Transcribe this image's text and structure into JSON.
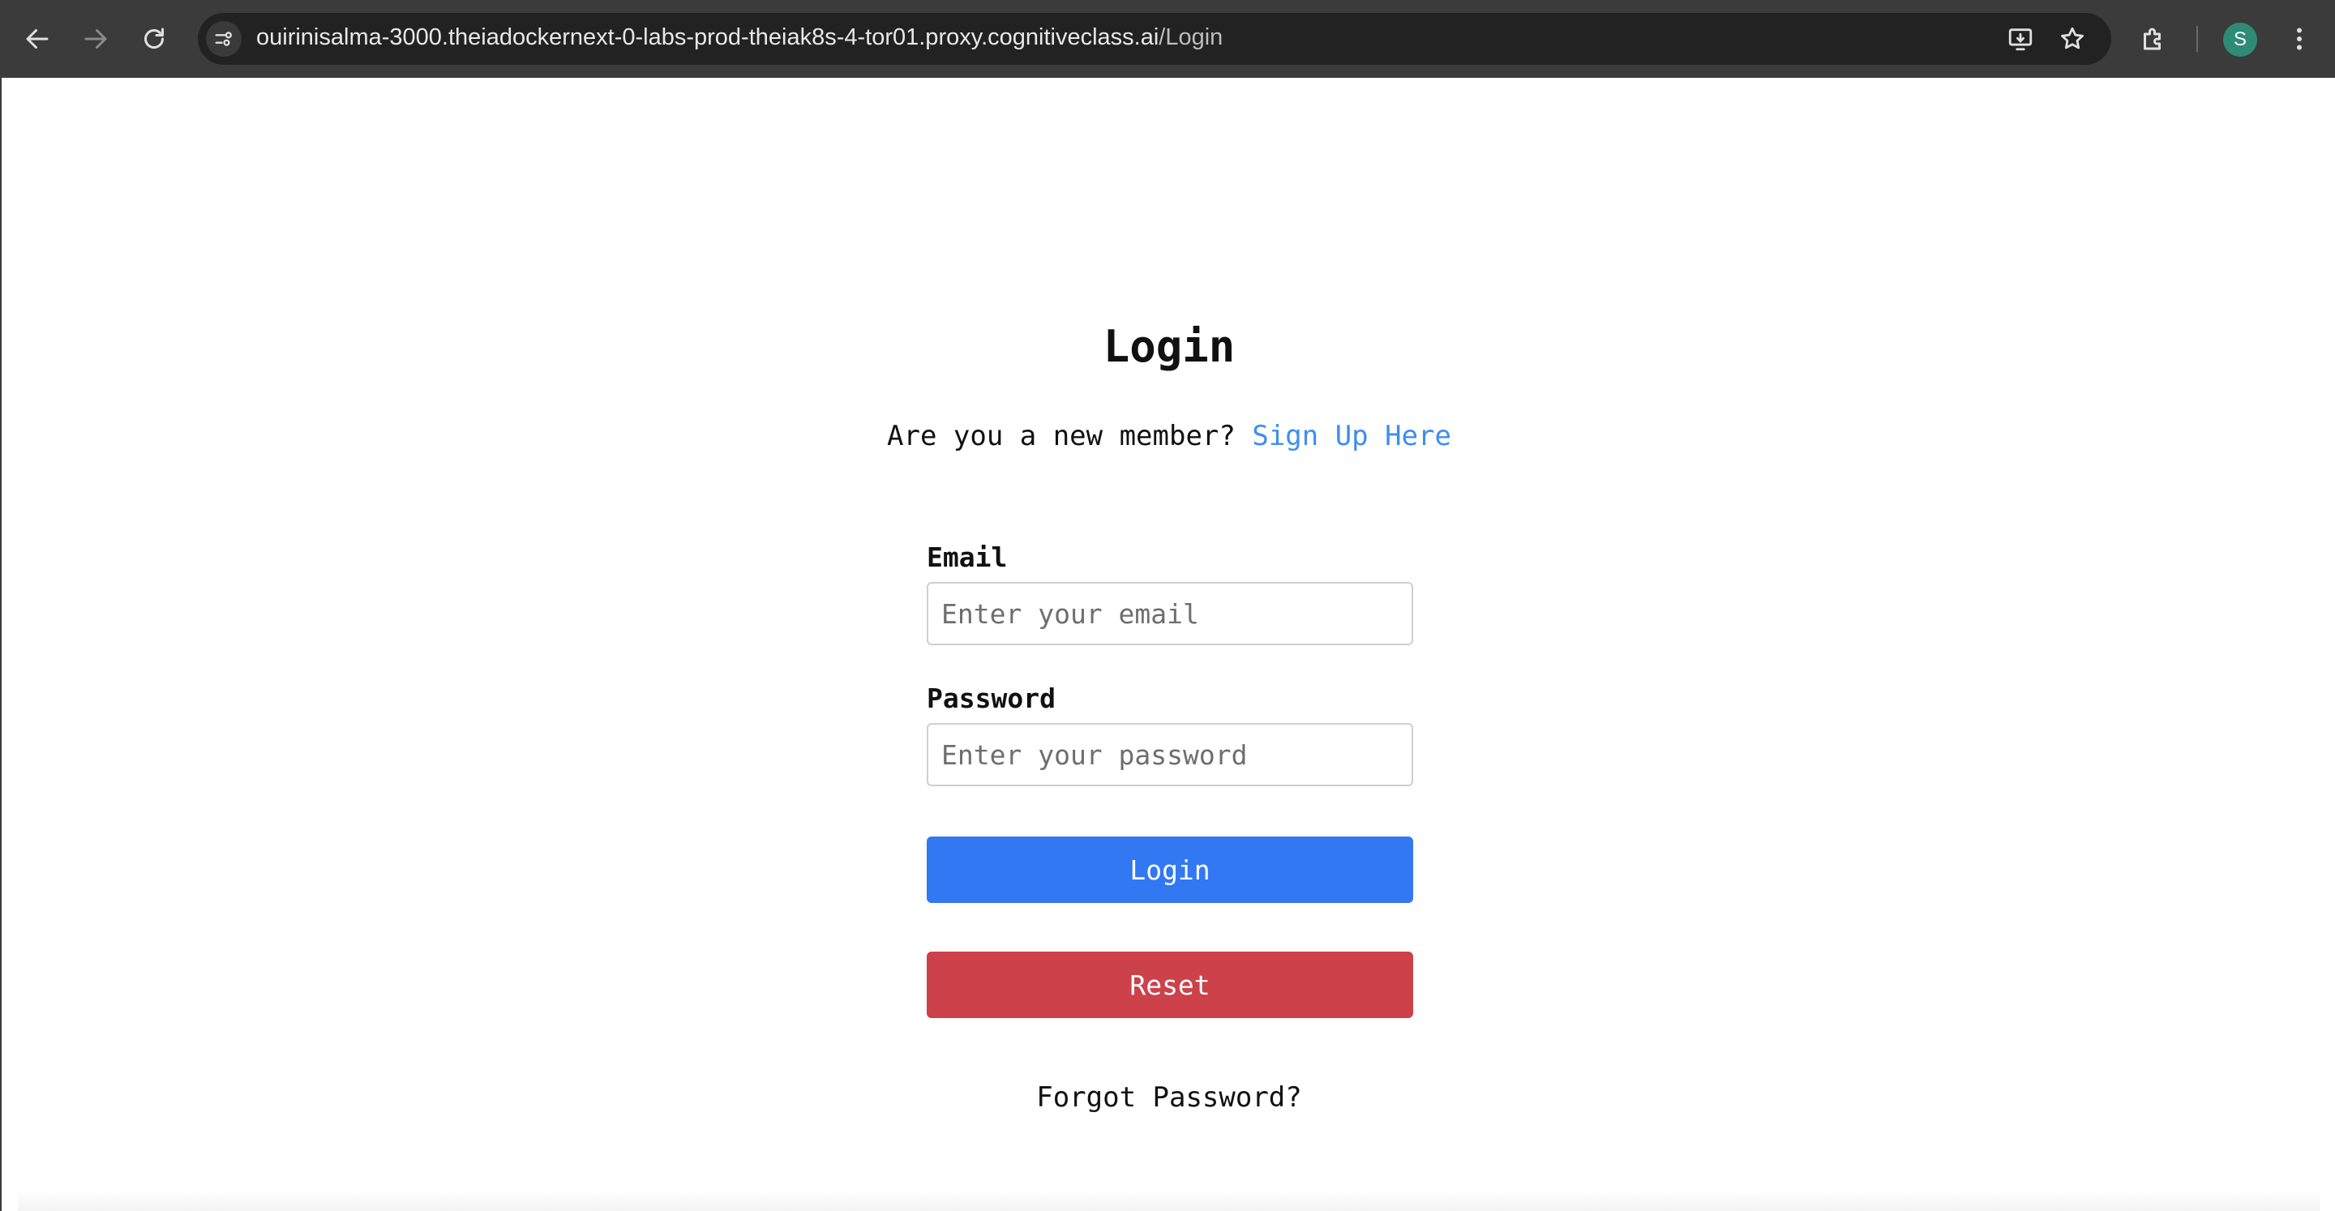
{
  "browser": {
    "url_host": "ouirinisalma-3000.theiadockernext-0-labs-prod-theiak8s-4-tor01.proxy.cognitiveclass.ai",
    "url_path": "/Login",
    "profile_initial": "S",
    "icons": [
      "back-arrow-icon",
      "forward-arrow-icon",
      "reload-icon",
      "site-info-icon",
      "install-app-icon",
      "bookmark-star-icon",
      "extensions-icon",
      "menu-dots-icon"
    ]
  },
  "login": {
    "title": "Login",
    "signup_prompt": "Are you a new member?",
    "signup_link": "Sign Up Here",
    "email_label": "Email",
    "email_placeholder": "Enter your email",
    "email_value": "",
    "password_label": "Password",
    "password_placeholder": "Enter your password",
    "password_value": "",
    "login_button": "Login",
    "reset_button": "Reset",
    "forgot_password": "Forgot Password?"
  },
  "colors": {
    "login_button": "#3178f2",
    "reset_button": "#cc414a",
    "link": "#3d8ef0",
    "chrome_bar": "#3b3b3b",
    "avatar": "#2e8b76"
  }
}
